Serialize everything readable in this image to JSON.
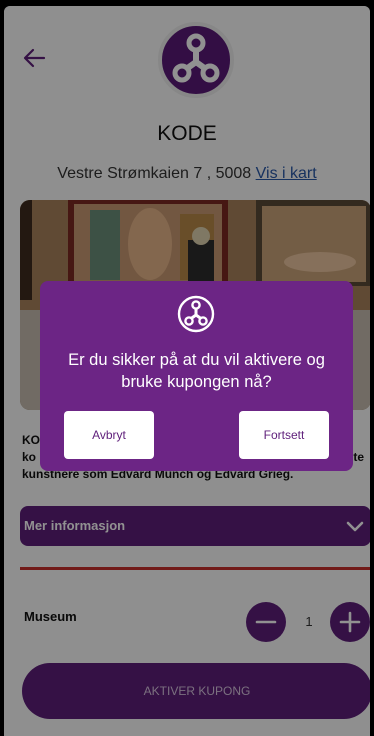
{
  "header": {
    "back_icon": "arrow-left-icon",
    "logo_icon": "three-node-logo-icon",
    "title": "KODE",
    "address": "Vestre Strømkaien 7 , 5008",
    "map_link": "Vis i kart"
  },
  "description": {
    "line1": "KO",
    "line2": "ko",
    "line3": "kunstnere som Edvard Munch og Edvard Grieg.",
    "tail": "te"
  },
  "info_section": {
    "label": "Mer informasjon",
    "icon": "chevron-down-icon"
  },
  "ticket": {
    "label": "Museum",
    "quantity": "1",
    "minus_icon": "minus-icon",
    "plus_icon": "plus-icon"
  },
  "activate_button": "AKTIVER KUPONG",
  "dialog": {
    "icon": "three-node-logo-icon",
    "message": "Er du sikker på at du vil aktivere og bruke kupongen nå?",
    "cancel_label": "Avbryt",
    "continue_label": "Fortsett"
  },
  "colors": {
    "brand_purple": "#5e1e7a",
    "dialog_purple": "#6c2585",
    "accent_red": "#c9302c",
    "link_blue": "#2a58a8"
  }
}
